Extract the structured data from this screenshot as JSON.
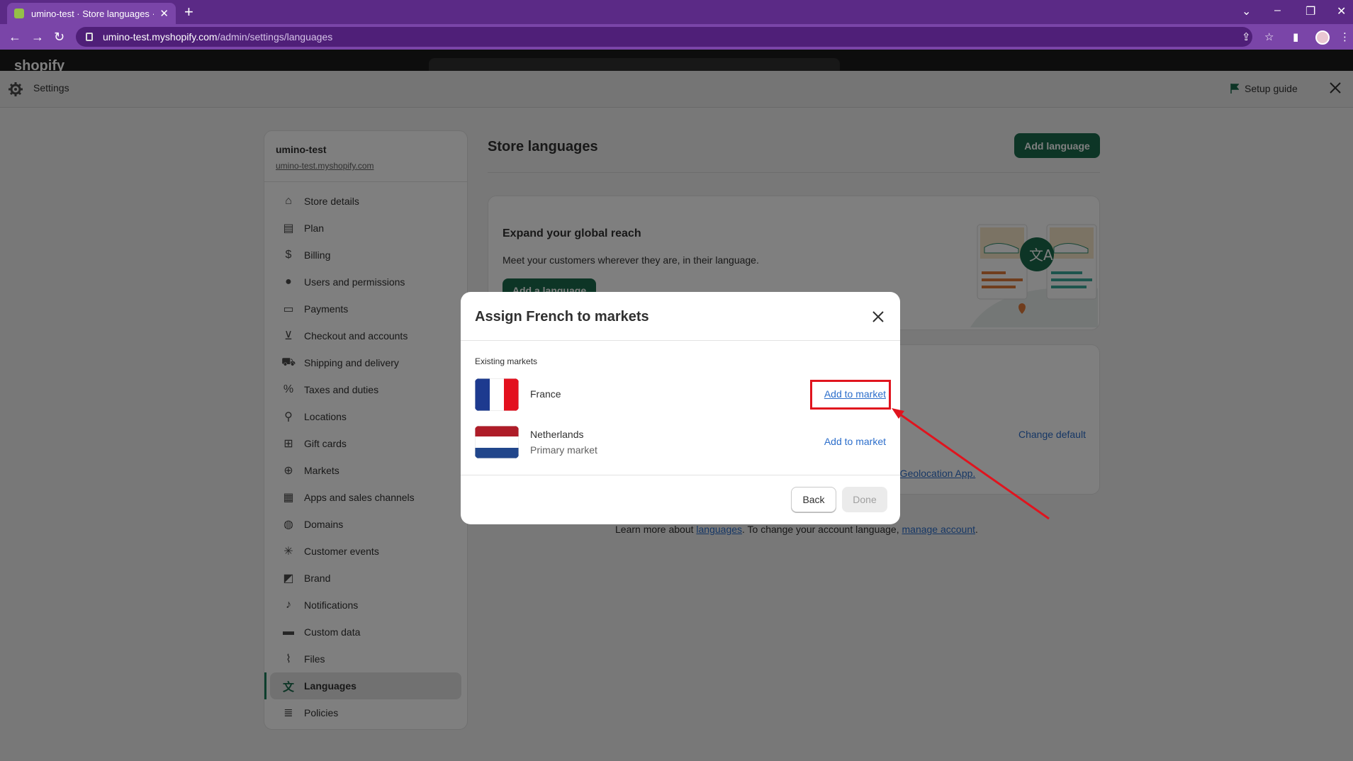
{
  "browser": {
    "tab_title": "umino-test · Store languages · Sh",
    "url_host": "umino-test.myshopify.com",
    "url_path": "/admin/settings/languages"
  },
  "shopify": {
    "logo_text": "shopify"
  },
  "settings_bar": {
    "title": "Settings",
    "setup_guide": "Setup guide"
  },
  "sidebar": {
    "store_name": "umino-test",
    "store_url": "umino-test.myshopify.com",
    "items": [
      {
        "label": "Store details",
        "icon": "store-icon"
      },
      {
        "label": "Plan",
        "icon": "plan-icon"
      },
      {
        "label": "Billing",
        "icon": "billing-icon"
      },
      {
        "label": "Users and permissions",
        "icon": "user-icon"
      },
      {
        "label": "Payments",
        "icon": "payments-icon"
      },
      {
        "label": "Checkout and accounts",
        "icon": "cart-icon"
      },
      {
        "label": "Shipping and delivery",
        "icon": "truck-icon"
      },
      {
        "label": "Taxes and duties",
        "icon": "tax-icon"
      },
      {
        "label": "Locations",
        "icon": "location-icon"
      },
      {
        "label": "Gift cards",
        "icon": "gift-icon"
      },
      {
        "label": "Markets",
        "icon": "markets-icon"
      },
      {
        "label": "Apps and sales channels",
        "icon": "apps-icon"
      },
      {
        "label": "Domains",
        "icon": "globe-icon"
      },
      {
        "label": "Customer events",
        "icon": "events-icon"
      },
      {
        "label": "Brand",
        "icon": "brand-icon"
      },
      {
        "label": "Notifications",
        "icon": "bell-icon"
      },
      {
        "label": "Custom data",
        "icon": "data-icon"
      },
      {
        "label": "Files",
        "icon": "paperclip-icon"
      },
      {
        "label": "Languages",
        "icon": "translate-icon",
        "active": true
      },
      {
        "label": "Policies",
        "icon": "policies-icon"
      }
    ]
  },
  "main": {
    "title": "Store languages",
    "add_language_button": "Add language",
    "expand_card": {
      "heading": "Expand your global reach",
      "text": "Meet your customers wherever they are, in their language.",
      "button": "Add a language"
    },
    "change_default": "Change default",
    "geo_link": "n Geolocation App.",
    "footer": {
      "prefix": "Learn more about ",
      "languages_link": "languages",
      "middle": ". To change your account language, ",
      "account_link": "manage account",
      "suffix": "."
    }
  },
  "modal": {
    "title": "Assign French to markets",
    "section_label": "Existing markets",
    "markets": [
      {
        "name": "France",
        "subtitle": "",
        "action": "Add to market"
      },
      {
        "name": "Netherlands",
        "subtitle": "Primary market",
        "action": "Add to market"
      }
    ],
    "back_button": "Back",
    "done_button": "Done"
  },
  "colors": {
    "primary_green": "#1a6b4d",
    "link_blue": "#2c6ecb",
    "annotation_red": "#e0141e",
    "browser_purple": "#7a45a8"
  }
}
